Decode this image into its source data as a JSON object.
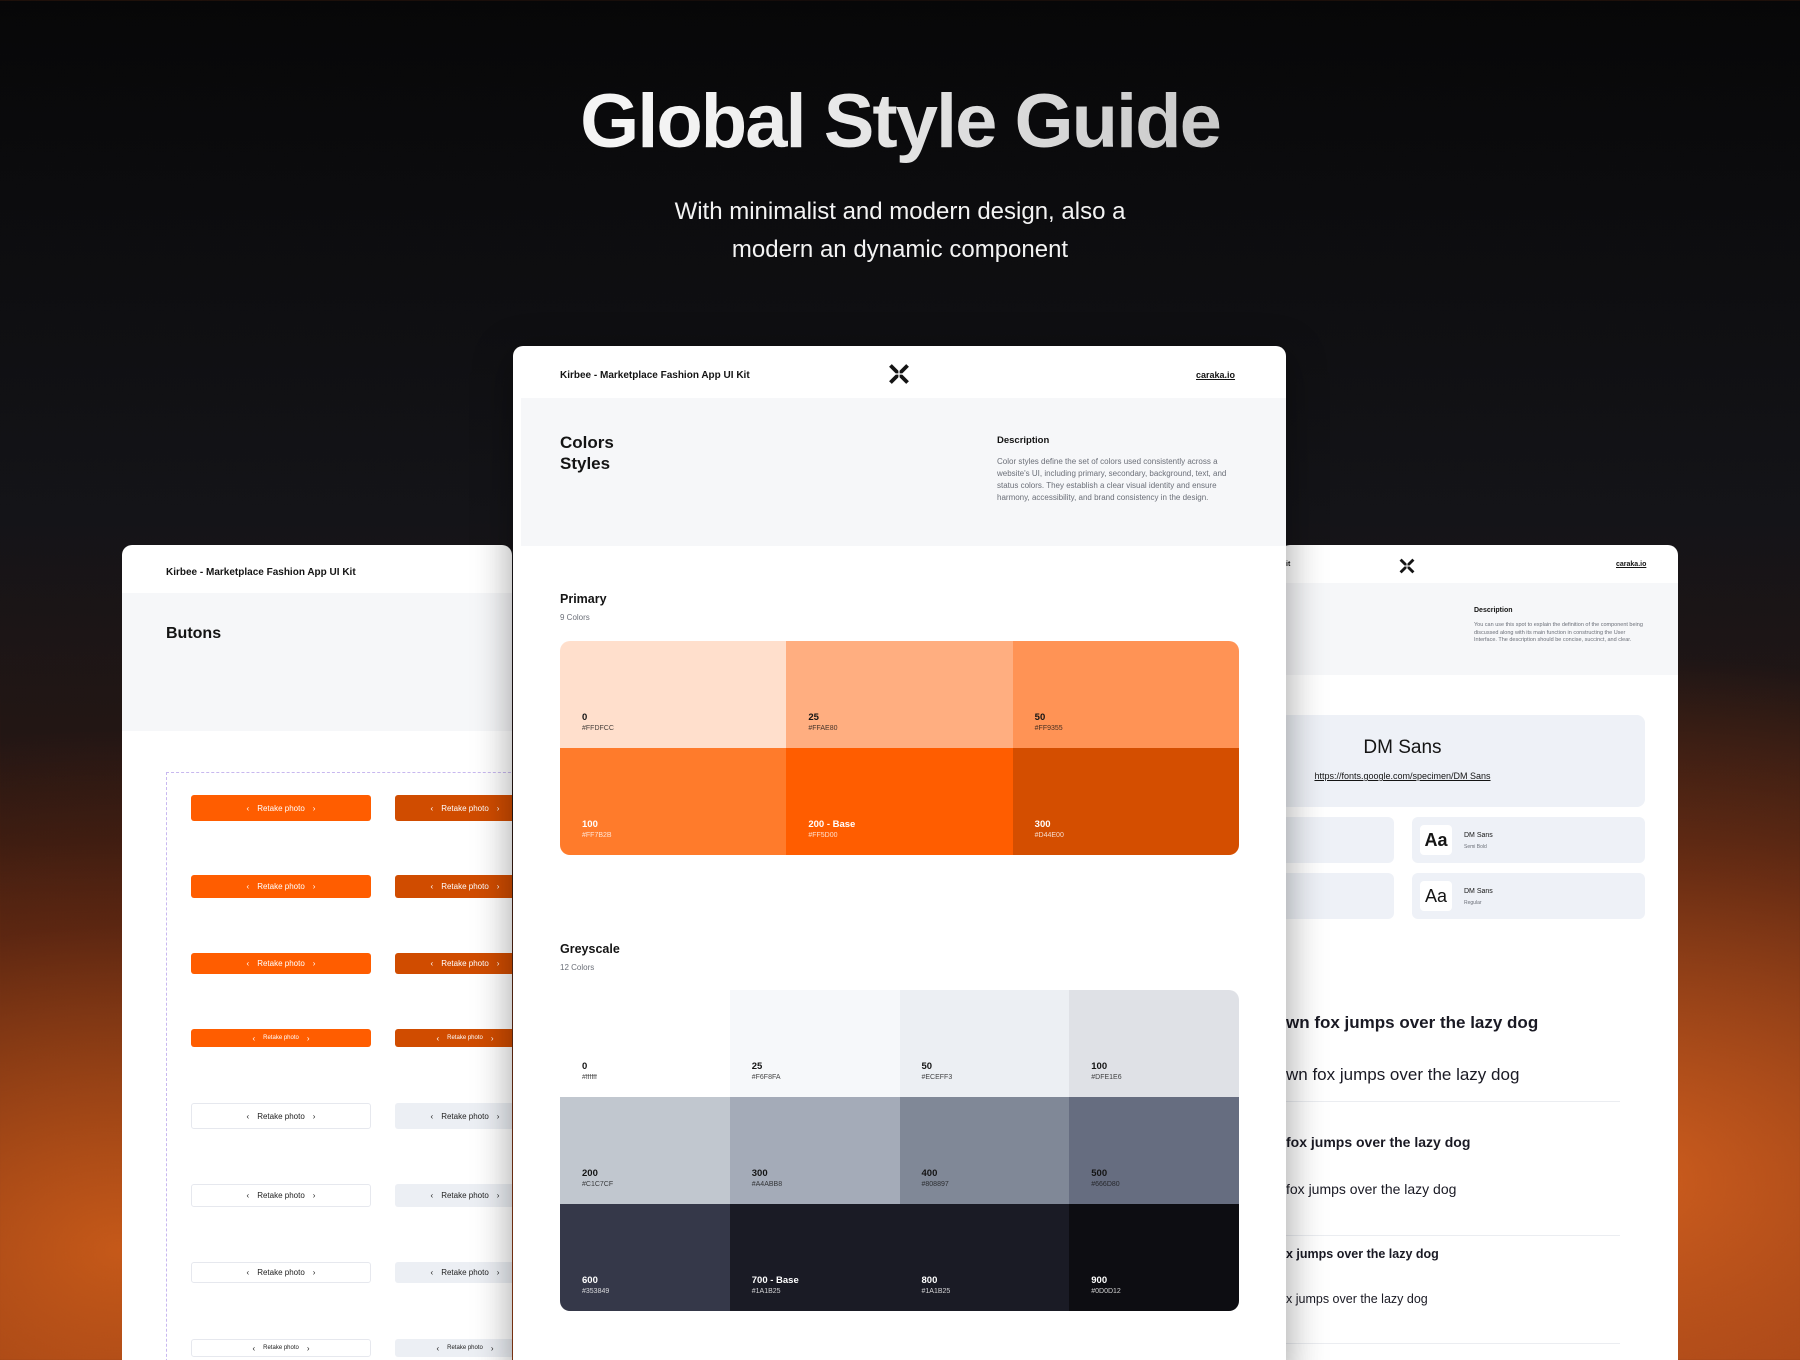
{
  "hero": {
    "title": "Global Style Guide",
    "subtitle_line1": "With minimalist and modern design, also a",
    "subtitle_line2": "modern an dynamic component"
  },
  "center_card": {
    "kit_name": "Kirbee - Marketplace Fashion App UI Kit",
    "logo_icon": "x-star-logo-icon",
    "site_link": "caraka.io",
    "title_line1": "Colors",
    "title_line2": "Styles",
    "description_heading": "Description",
    "description_text": "Color styles define the set of colors used consistently across a website's UI, including primary, secondary, background, text, and status colors. They establish a clear visual identity and ensure harmony, accessibility, and brand consistency in the design.",
    "primary": {
      "title": "Primary",
      "count": "9 Colors",
      "swatches": [
        {
          "name": "0",
          "hex": "#FFDFCC",
          "color": "#FFDFCC",
          "text_color": "#141414"
        },
        {
          "name": "25",
          "hex": "#FFAE80",
          "color": "#FFAE80",
          "text_color": "#141414"
        },
        {
          "name": "50",
          "hex": "#FF9355",
          "color": "#FF9355",
          "text_color": "#141414"
        },
        {
          "name": "100",
          "hex": "#FF7B2B",
          "color": "#FF7B2B",
          "text_color": "#ffffff"
        },
        {
          "name": "200 - Base",
          "hex": "#FF5D00",
          "color": "#FF5D00",
          "text_color": "#ffffff"
        },
        {
          "name": "300",
          "hex": "#D44E00",
          "color": "#D44E00",
          "text_color": "#ffffff"
        }
      ]
    },
    "greyscale": {
      "title": "Greyscale",
      "count": "12 Colors",
      "swatches": [
        {
          "name": "0",
          "hex": "#ffffff",
          "color": "#ffffff",
          "text_color": "#141414"
        },
        {
          "name": "25",
          "hex": "#F6F8FA",
          "color": "#F6F8FA",
          "text_color": "#141414"
        },
        {
          "name": "50",
          "hex": "#ECEFF3",
          "color": "#ECEFF3",
          "text_color": "#141414"
        },
        {
          "name": "100",
          "hex": "#DFE1E6",
          "color": "#DFE1E6",
          "text_color": "#141414"
        },
        {
          "name": "200",
          "hex": "#C1C7CF",
          "color": "#C1C7CF",
          "text_color": "#141414"
        },
        {
          "name": "300",
          "hex": "#A4ABB8",
          "color": "#A4ABB8",
          "text_color": "#141414"
        },
        {
          "name": "400",
          "hex": "#808897",
          "color": "#808897",
          "text_color": "#141414"
        },
        {
          "name": "500",
          "hex": "#666D80",
          "color": "#666D80",
          "text_color": "#141414"
        },
        {
          "name": "600",
          "hex": "#353849",
          "color": "#353849",
          "text_color": "#ffffff"
        },
        {
          "name": "700 - Base",
          "hex": "#1A1B25",
          "color": "#1A1B25",
          "text_color": "#ffffff"
        },
        {
          "name": "800",
          "hex": "#1A1B25",
          "color": "#1A1B25",
          "text_color": "#ffffff"
        },
        {
          "name": "900",
          "hex": "#0D0D12",
          "color": "#0D0D12",
          "text_color": "#ffffff"
        }
      ]
    }
  },
  "left_card": {
    "kit_name": "Kirbee - Marketplace Fashion App UI Kit",
    "title": "Butons",
    "button_label": "Retake photo",
    "chevron_left_icon": "chevron-left-icon",
    "chevron_right_icon": "chevron-right-icon"
  },
  "right_card": {
    "kit_name_fragment": "it",
    "logo_icon": "x-star-logo-icon",
    "site_link": "caraka.io",
    "description_heading": "Description",
    "description_text": "You can use this spot to explain the definition of the component being discussed along with its main function in constructing the User Interface. The description should be concise, succinct, and clear.",
    "font_name": "DM Sans",
    "font_link": "https://fonts.google.com/specimen/DM Sans",
    "weights": [
      {
        "sample": "Aa",
        "label": "DM Sans",
        "style": "Semi Bold"
      },
      {
        "sample": "Aa",
        "label": "DM Sans",
        "style": "Regular"
      }
    ],
    "pangrams": [
      "wn fox jumps over the lazy dog",
      "wn fox jumps over the lazy dog",
      "fox jumps over the lazy dog",
      "fox jumps over the lazy dog",
      "x jumps over the lazy dog",
      "x jumps over the lazy dog"
    ]
  }
}
